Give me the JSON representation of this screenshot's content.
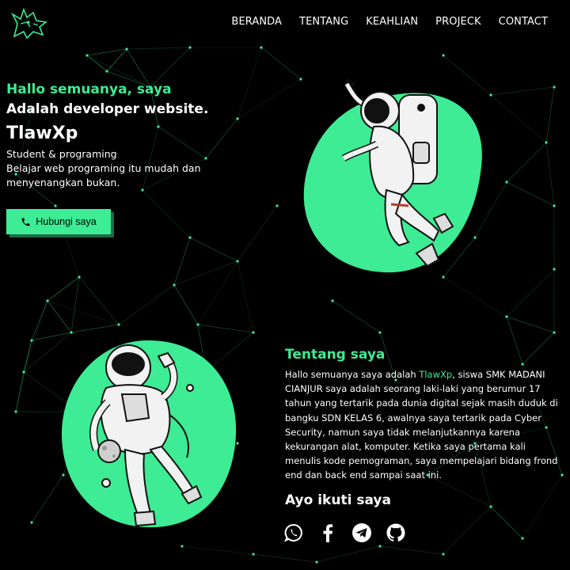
{
  "nav": {
    "items": [
      "BERANDA",
      "TENTANG",
      "KEAHLIAN",
      "PROJECK",
      "CONTACT"
    ]
  },
  "hero": {
    "greeting": "Hallo semuanya, saya",
    "line2": "Adalah developer website.",
    "name": "TlawXp",
    "sub1": "Student & programing",
    "sub2": "Belajar web programing itu mudah dan",
    "sub3": "menyenangkan bukan.",
    "cta": "Hubungi saya"
  },
  "about": {
    "title": "Tentang saya",
    "text_before": "Hallo semuanya saya adalah ",
    "highlight": "TlawXp",
    "text_after": ", siswa SMK MADANI CIANJUR saya adalah seorang laki-laki yang berumur 17 tahun yang tertarik pada dunia digital sejak masih duduk di bangku SDN KELAS 6, awalnya saya tertarik pada Cyber Security, namun saya tidak melanjutkannya karena kekurangan alat, komputer. Ketika saya pertama kali menulis kode pemograman, saya mempelajari bidang frond end dan back end sampai saat ini."
  },
  "follow": {
    "title": "Ayo ikuti saya",
    "icons": [
      "whatsapp-icon",
      "facebook-icon",
      "telegram-icon",
      "github-icon"
    ]
  },
  "colors": {
    "accent": "#3dec94",
    "background": "#000000"
  }
}
